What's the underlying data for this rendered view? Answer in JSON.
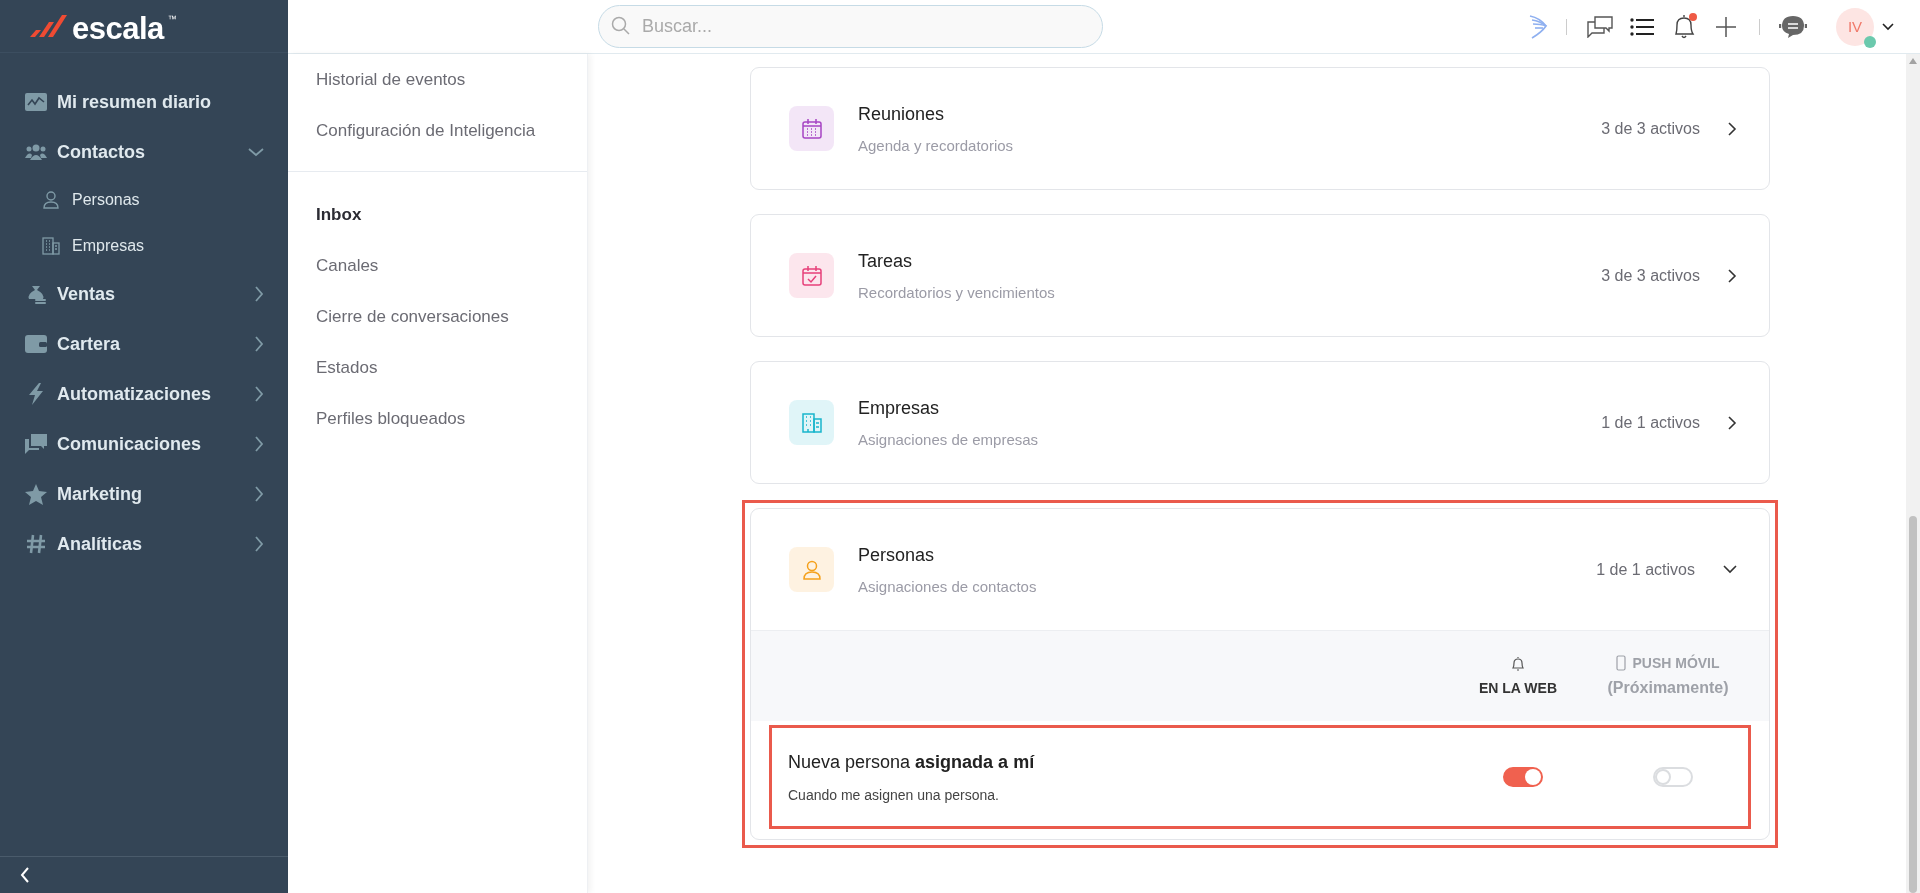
{
  "sidebar": {
    "logo_text": "escala",
    "trademark": "™",
    "items": [
      {
        "label": "Mi resumen diario",
        "kind": "link"
      },
      {
        "label": "Contactos",
        "kind": "group",
        "expanded": true,
        "children": [
          {
            "label": "Personas"
          },
          {
            "label": "Empresas"
          }
        ]
      },
      {
        "label": "Ventas",
        "kind": "group",
        "expanded": false
      },
      {
        "label": "Cartera",
        "kind": "group",
        "expanded": false
      },
      {
        "label": "Automatizaciones",
        "kind": "group",
        "expanded": false
      },
      {
        "label": "Comunicaciones",
        "kind": "group",
        "expanded": false
      },
      {
        "label": "Marketing",
        "kind": "group",
        "expanded": false
      },
      {
        "label": "Analíticas",
        "kind": "group",
        "expanded": false
      }
    ]
  },
  "topbar": {
    "search": {
      "placeholder": "Buscar..."
    },
    "notifications_unread": true,
    "avatar": {
      "initials": "IV",
      "online": true
    }
  },
  "settings_menu": {
    "groups": [
      {
        "items": [
          {
            "label": "Historial de eventos"
          },
          {
            "label": "Configuración de Inteligencia"
          }
        ]
      },
      {
        "title": "Inbox",
        "items": [
          {
            "label": "Canales"
          },
          {
            "label": "Cierre de conversaciones"
          },
          {
            "label": "Estados"
          },
          {
            "label": "Perfiles bloqueados"
          }
        ]
      }
    ]
  },
  "cards": [
    {
      "title": "Reuniones",
      "subtitle": "Agenda y recordatorios",
      "count": "3 de 3 activos",
      "color": "#a744c4",
      "expanded": false,
      "highlighted": false
    },
    {
      "title": "Tareas",
      "subtitle": "Recordatorios y vencimientos",
      "count": "3 de 3 activos",
      "color": "#e6407a",
      "expanded": false,
      "highlighted": false
    },
    {
      "title": "Empresas",
      "subtitle": "Asignaciones de empresas",
      "count": "1 de 1 activos",
      "color": "#18b5cc",
      "expanded": false,
      "highlighted": false
    },
    {
      "title": "Personas",
      "subtitle": "Asignaciones de contactos",
      "count": "1 de 1 activos",
      "color": "#f5a11c",
      "expanded": true,
      "highlighted": true,
      "columns": [
        {
          "label": "EN LA WEB",
          "disabled": false
        },
        {
          "label": "PUSH MÓVIL",
          "note": "(Próximamente)",
          "disabled": true
        }
      ],
      "rows": [
        {
          "title": "Nueva persona **asignada a mí**",
          "description": "Cuando me asignen una persona.",
          "highlighted": true,
          "toggles": [
            {
              "on": true,
              "disabled": false
            },
            {
              "on": false,
              "disabled": true
            }
          ]
        }
      ]
    }
  ]
}
